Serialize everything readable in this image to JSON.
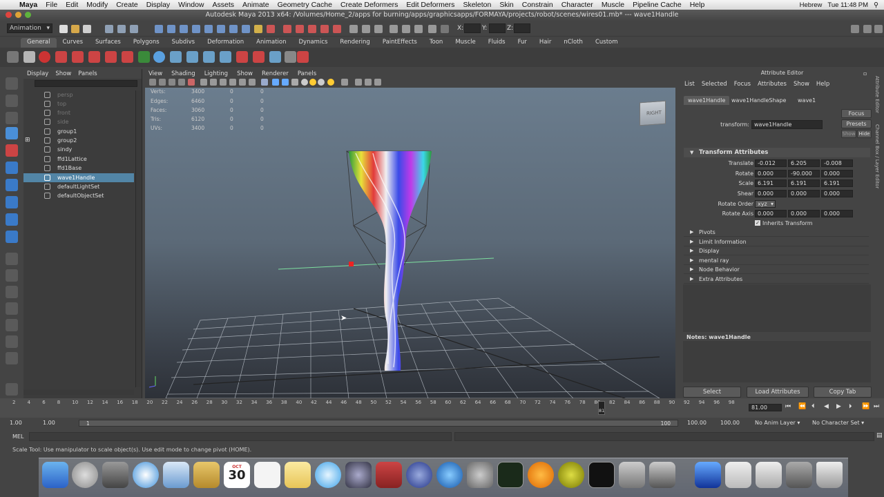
{
  "menubar": {
    "app": "Maya",
    "items": [
      "File",
      "Edit",
      "Modify",
      "Create",
      "Display",
      "Window",
      "Assets",
      "Animate",
      "Geometry Cache",
      "Create Deformers",
      "Edit Deformers",
      "Skeleton",
      "Skin",
      "Constrain",
      "Character",
      "Muscle",
      "Pipeline Cache",
      "Help"
    ],
    "input_source": "Hebrew",
    "clock": "Tue 11:48 PM"
  },
  "window_title": "Autodesk Maya 2013 x64: /Volumes/Home_2/apps for burning/apps/graphicsapps/FORMAYA/projects/robot/scenes/wires01.mb*  ---  wave1Handle",
  "statusline": {
    "menuset": "Animation",
    "x_label": "X:",
    "y_label": "Y:",
    "z_label": "Z:"
  },
  "shelf_tabs": [
    "General",
    "Curves",
    "Surfaces",
    "Polygons",
    "Subdivs",
    "Deformation",
    "Animation",
    "Dynamics",
    "Rendering",
    "PaintEffects",
    "Toon",
    "Muscle",
    "Fluids",
    "Fur",
    "Hair",
    "nCloth",
    "Custom"
  ],
  "outliner": {
    "menu": [
      "Display",
      "Show",
      "Panels"
    ],
    "items": [
      {
        "name": "persp",
        "dim": true
      },
      {
        "name": "top",
        "dim": true
      },
      {
        "name": "front",
        "dim": true
      },
      {
        "name": "side",
        "dim": true
      },
      {
        "name": "group1",
        "dim": false
      },
      {
        "name": "group2",
        "dim": false
      },
      {
        "name": "sindy",
        "dim": false
      },
      {
        "name": "ffd1Lattice",
        "dim": false
      },
      {
        "name": "ffd1Base",
        "dim": false
      },
      {
        "name": "wave1Handle",
        "dim": false,
        "selected": true
      },
      {
        "name": "defaultLightSet",
        "dim": false
      },
      {
        "name": "defaultObjectSet",
        "dim": false
      }
    ]
  },
  "viewport": {
    "menu": [
      "View",
      "Shading",
      "Lighting",
      "Show",
      "Renderer",
      "Panels"
    ],
    "hud": [
      {
        "label": "Verts:",
        "a": "3400",
        "b": "0",
        "c": "0"
      },
      {
        "label": "Edges:",
        "a": "6460",
        "b": "0",
        "c": "0"
      },
      {
        "label": "Faces:",
        "a": "3060",
        "b": "0",
        "c": "0"
      },
      {
        "label": "Tris:",
        "a": "6120",
        "b": "0",
        "c": "0"
      },
      {
        "label": "UVs:",
        "a": "3400",
        "b": "0",
        "c": "0"
      }
    ],
    "viewcube": "RIGHT"
  },
  "attribute_editor": {
    "title": "Attribute Editor",
    "menu": [
      "List",
      "Selected",
      "Focus",
      "Attributes",
      "Show",
      "Help"
    ],
    "tabs": [
      "wave1Handle",
      "wave1HandleShape",
      "wave1"
    ],
    "focus_btn": "Focus",
    "presets_btn": "Presets",
    "show_btn": "Show",
    "hide_btn": "Hide",
    "transform_label": "transform:",
    "transform_value": "wave1Handle",
    "section_transform": "Transform Attributes",
    "translate_label": "Translate",
    "translate": [
      "-0.012",
      "6.205",
      "-0.008"
    ],
    "rotate_label": "Rotate",
    "rotate": [
      "0.000",
      "-90.000",
      "0.000"
    ],
    "scale_label": "Scale",
    "scale": [
      "6.191",
      "6.191",
      "6.191"
    ],
    "shear_label": "Shear",
    "shear": [
      "0.000",
      "0.000",
      "0.000"
    ],
    "rotate_order_label": "Rotate Order",
    "rotate_order": "xyz",
    "rotate_axis_label": "Rotate Axis",
    "rotate_axis": [
      "0.000",
      "0.000",
      "0.000"
    ],
    "inherits_label": "Inherits Transform",
    "sections": [
      "Pivots",
      "Limit Information",
      "Display",
      "mental ray",
      "Node Behavior",
      "Extra Attributes"
    ],
    "notes_label": "Notes:  wave1Handle",
    "btn_select": "Select",
    "btn_load": "Load Attributes",
    "btn_copy": "Copy Tab",
    "side_tabs": [
      "Attribute Editor",
      "Channel Box / Layer Editor"
    ]
  },
  "timeline": {
    "ticks": [
      "2",
      "4",
      "6",
      "8",
      "10",
      "12",
      "14",
      "16",
      "18",
      "20",
      "22",
      "24",
      "26",
      "28",
      "30",
      "32",
      "34",
      "36",
      "38",
      "40",
      "42",
      "44",
      "46",
      "48",
      "50",
      "52",
      "54",
      "56",
      "58",
      "60",
      "62",
      "64",
      "66",
      "68",
      "70",
      "72",
      "74",
      "76",
      "78",
      "80",
      "82",
      "84",
      "86",
      "88",
      "90",
      "92",
      "94",
      "96",
      "98"
    ],
    "current_frame": "81.00",
    "range_start": "1.00",
    "range_start2": "1.00",
    "range_slider_start": "1",
    "range_slider_end": "100",
    "range_end": "100.00",
    "range_end2": "100.00",
    "anim_layer": "No Anim Layer",
    "character_set": "No Character Set",
    "current_marker": "81"
  },
  "command_line": {
    "label": "MEL"
  },
  "help_line": "Scale Tool: Use manipulator to scale object(s). Use edit mode to change pivot (HOME).",
  "dock": {
    "calendar_day": "30",
    "calendar_month": "OCT"
  },
  "colors": {
    "selection": "#5285a6",
    "panel": "#444444",
    "field": "#2b2b2b"
  }
}
